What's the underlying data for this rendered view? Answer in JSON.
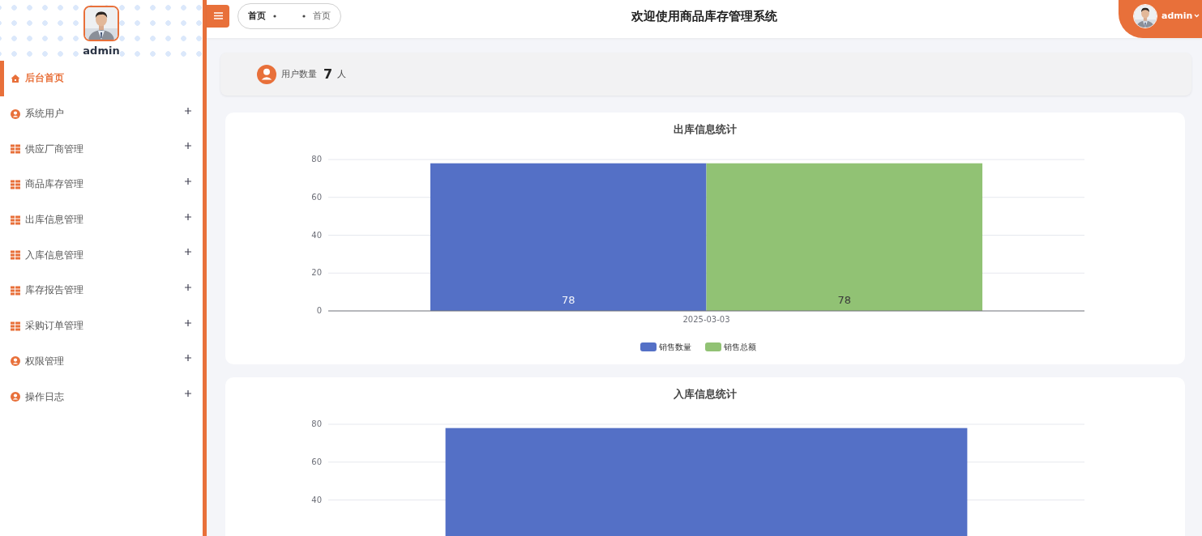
{
  "sidebar": {
    "user": {
      "name": "admin"
    },
    "items": [
      {
        "label": "后台首页",
        "kind": "home",
        "selected": true,
        "expandable": false
      },
      {
        "label": "系统用户",
        "kind": "user",
        "selected": false,
        "expandable": true
      },
      {
        "label": "供应厂商管理",
        "kind": "grid",
        "selected": false,
        "expandable": true
      },
      {
        "label": "商品库存管理",
        "kind": "grid",
        "selected": false,
        "expandable": true
      },
      {
        "label": "出库信息管理",
        "kind": "grid",
        "selected": false,
        "expandable": true
      },
      {
        "label": "入库信息管理",
        "kind": "grid",
        "selected": false,
        "expandable": true
      },
      {
        "label": "库存报告管理",
        "kind": "grid",
        "selected": false,
        "expandable": true
      },
      {
        "label": "采购订单管理",
        "kind": "grid",
        "selected": false,
        "expandable": true
      },
      {
        "label": "权限管理",
        "kind": "user",
        "selected": false,
        "expandable": true
      },
      {
        "label": "操作日志",
        "kind": "user",
        "selected": false,
        "expandable": true
      }
    ]
  },
  "topbar": {
    "breadcrumbs": [
      {
        "label": "首页",
        "selected": true
      },
      {
        "label": "首页",
        "selected": false
      }
    ],
    "title": "欢迎使用商品库存管理系统",
    "user": "admin"
  },
  "stats": {
    "label": "用户数量",
    "value": "7",
    "unit": "人"
  },
  "charts": [
    {
      "chart_data": {
        "type": "bar",
        "title": "出库信息统计",
        "categories": [
          "2025-03-03"
        ],
        "series": [
          {
            "name": "销售数量",
            "color": "#5470c6",
            "values": [
              78
            ]
          },
          {
            "name": "销售总额",
            "color": "#91c274",
            "values": [
              78
            ]
          }
        ],
        "ylim": [
          0,
          80
        ],
        "yticks": [
          0,
          20,
          40,
          60,
          80
        ],
        "grid": true,
        "legend": true,
        "data_labels": true
      }
    },
    {
      "chart_data": {
        "type": "bar",
        "title": "入库信息统计",
        "series": [
          {
            "color": "#5470c6",
            "values": [
              78
            ]
          }
        ],
        "ylim": [
          0,
          80
        ],
        "yticks": [
          40,
          60,
          80
        ],
        "grid": true
      }
    }
  ]
}
